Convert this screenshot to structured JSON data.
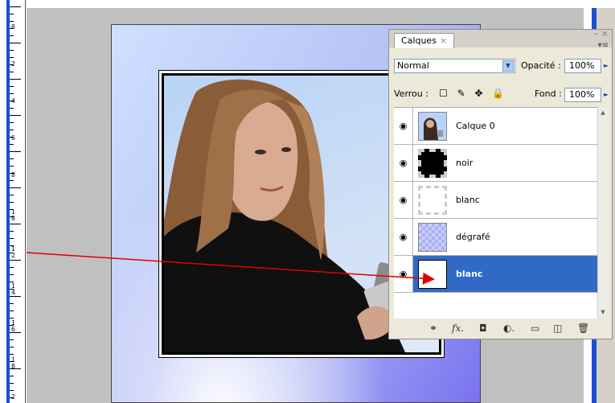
{
  "ruler": {
    "labels": [
      "0",
      "2",
      "4",
      "6",
      "8",
      "1\n0",
      "1\n2",
      "1\n4",
      "1\n6",
      "1\n8",
      "2"
    ]
  },
  "panel": {
    "tab_label": "Calques",
    "tab_close": "×",
    "win_controls": "– ×",
    "blend_mode": "Normal",
    "opacity_label": "Opacité :",
    "opacity_value": "100%",
    "lock_label": "Verrou :",
    "lock_icons": "☐ ✎ ✥ 🔒",
    "fill_label": "Fond :",
    "fill_value": "100%",
    "eye_glyph": "◉",
    "layers": [
      {
        "name": "Calque 0",
        "thumb": "photo"
      },
      {
        "name": "noir",
        "thumb": "black"
      },
      {
        "name": "blanc",
        "thumb": "white-transparent"
      },
      {
        "name": "dégrafé",
        "thumb": "gradient"
      },
      {
        "name": "blanc",
        "thumb": "white",
        "selected": true
      }
    ],
    "bottom_icons": [
      "link-icon",
      "fx-icon",
      "mask-icon",
      "adjustment-icon",
      "group-icon",
      "new-layer-icon",
      "trash-icon"
    ],
    "bottom_glyphs": [
      "⚭",
      "fx.",
      "◘",
      "◐.",
      "▭",
      "◫",
      "🗑"
    ]
  },
  "colors": {
    "selection": "#316ac5",
    "arrow": "#e00000",
    "ruler_blue": "#1a4fd0"
  }
}
